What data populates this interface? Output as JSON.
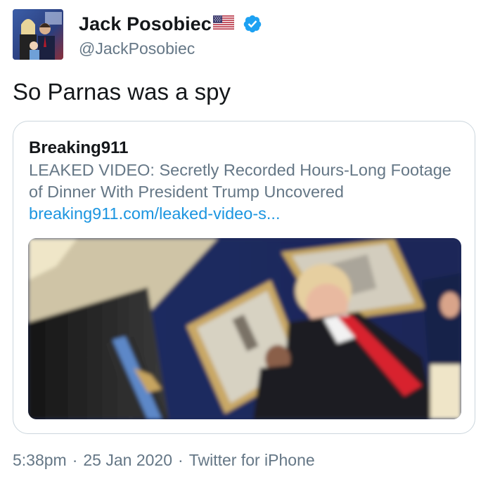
{
  "author": {
    "display_name": "Jack Posobiec",
    "handle": "@JackPosobiec",
    "flag": "us-flag-icon",
    "verified": true,
    "verified_color": "#1da1f2"
  },
  "tweet": {
    "text": "So Parnas was a spy"
  },
  "card": {
    "source": "Breaking911",
    "description": "LEAKED VIDEO: Secretly Recorded Hours-Long Footage of Dinner With President Trump Uncovered",
    "link": "breaking911.com/leaked-video-s..."
  },
  "meta": {
    "time": "5:38pm",
    "separator": "·",
    "date": "25 Jan 2020",
    "client": "Twitter for iPhone"
  },
  "colors": {
    "text_primary": "#14171a",
    "text_secondary": "#657786",
    "link": "#1b95e0",
    "border": "#ccd6dd"
  }
}
